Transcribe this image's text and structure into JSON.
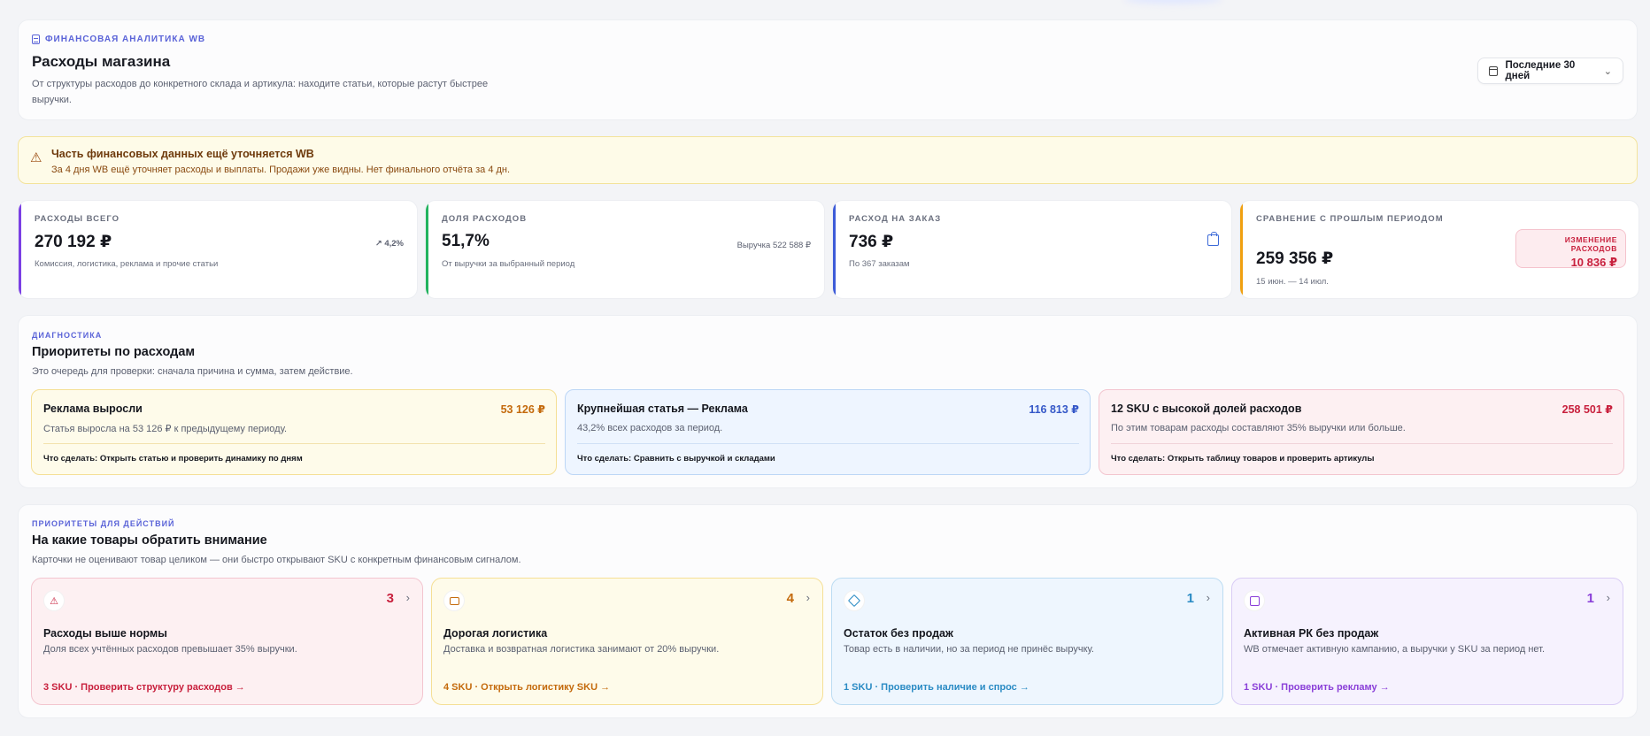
{
  "header": {
    "eyebrow": "ФИНАНСОВАЯ АНАЛИТИКА WB",
    "title": "Расходы магазина",
    "subtitle": "От структуры расходов до конкретного склада и артикула: находите статьи, которые растут быстрее выручки.",
    "period_label": "Последние 30 дней"
  },
  "warning": {
    "title": "Часть финансовых данных ещё уточняется WB",
    "text": "За 4 дня WB ещё уточняет расходы и выплаты. Продажи уже видны. Нет финального отчёта за 4 дн."
  },
  "kpis": {
    "total": {
      "label": "РАСХОДЫ ВСЕГО",
      "value": "270 192 ₽",
      "trend": "↗ 4,2%",
      "note": "Комиссия, логистика, реклама и прочие статьи",
      "accent": "#7b3fe4"
    },
    "share": {
      "label": "ДОЛЯ РАСХОДОВ",
      "value": "51,7%",
      "side": "Выручка 522 588 ₽",
      "note": "От выручки за выбранный период",
      "accent": "#22b35e"
    },
    "per_order": {
      "label": "РАСХОД НА ЗАКАЗ",
      "value": "736 ₽",
      "note": "По 367 заказам",
      "icon": "bag-icon",
      "accent": "#3d5bd8"
    },
    "compare": {
      "label": "СРАВНЕНИЕ С ПРОШЛЫМ ПЕРИОДОМ",
      "value": "259 356 ₽",
      "note": "15 июн. — 14 июл.",
      "change_label": "ИЗМЕНЕНИЕ РАСХОДОВ",
      "change_value": "10 836 ₽",
      "accent": "#f0a010"
    }
  },
  "diagnostics": {
    "eyebrow": "ДИАГНОСТИКА",
    "title": "Приоритеты по расходам",
    "subtitle": "Это очередь для проверки: сначала причина и сумма, затем действие.",
    "cards": [
      {
        "title": "Реклама выросли",
        "amount": "53 126 ₽",
        "desc": "Статья выросла на 53 126 ₽ к предыдущему периоду.",
        "action": "Что сделать: Открыть статью и проверить динамику по дням"
      },
      {
        "title": "Крупнейшая статья — Реклама",
        "amount": "116 813 ₽",
        "desc": "43,2% всех расходов за период.",
        "action": "Что сделать: Сравнить с выручкой и складами"
      },
      {
        "title": "12 SKU с высокой долей расходов",
        "amount": "258 501 ₽",
        "desc": "По этим товарам расходы составляют 35% выручки или больше.",
        "action": "Что сделать: Открыть таблицу товаров и проверить артикулы"
      }
    ]
  },
  "actions": {
    "eyebrow": "ПРИОРИТЕТЫ ДЛЯ ДЕЙСТВИЙ",
    "title": "На какие товары обратить внимание",
    "subtitle": "Карточки не оценивают товар целиком — они быстро открывают SKU с конкретным финансовым сигналом.",
    "cards": [
      {
        "icon": "warning-icon",
        "count": "3",
        "arrow": "›",
        "title": "Расходы выше нормы",
        "desc": "Доля всех учтённых расходов превышает 35% выручки.",
        "link": "3 SKU · Проверить структуру расходов →"
      },
      {
        "icon": "box-icon",
        "count": "4",
        "arrow": "›",
        "title": "Дорогая логистика",
        "desc": "Доставка и возвратная логистика занимают от 20% выручки.",
        "link": "4 SKU · Открыть логистику SKU →"
      },
      {
        "icon": "package-icon",
        "count": "1",
        "arrow": "›",
        "title": "Остаток без продаж",
        "desc": "Товар есть в наличии, но за период не принёс выручку.",
        "link": "1 SKU · Проверить наличие и спрос →"
      },
      {
        "icon": "bag-icon",
        "count": "1",
        "arrow": "›",
        "title": "Активная РК без продаж",
        "desc": "WB отмечает активную кампанию, а выручки у SKU за период нет.",
        "link": "1 SKU · Проверить рекламу →"
      }
    ]
  }
}
